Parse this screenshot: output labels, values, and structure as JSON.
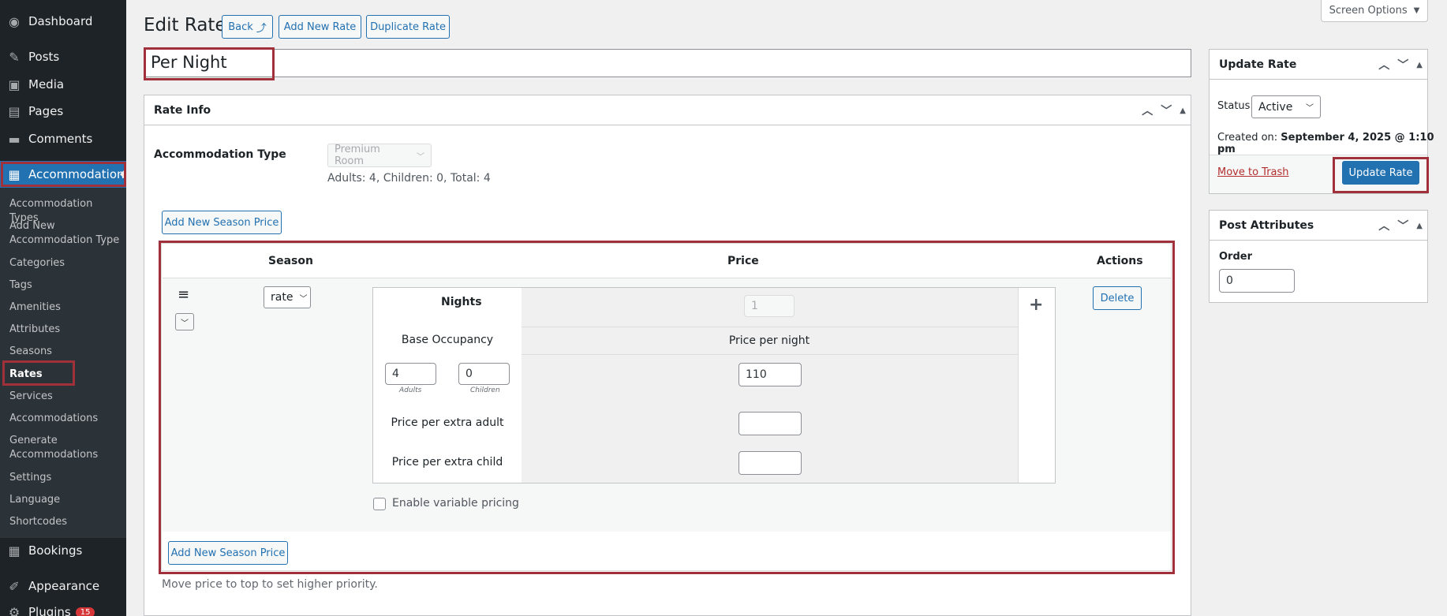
{
  "sidebar": {
    "top_items": [
      {
        "label": "Dashboard",
        "icon": "dashboard-icon"
      },
      {
        "label": "Posts",
        "icon": "pin-icon"
      },
      {
        "label": "Media",
        "icon": "media-icon"
      },
      {
        "label": "Pages",
        "icon": "page-icon"
      },
      {
        "label": "Comments",
        "icon": "comment-icon"
      },
      {
        "label": "Accommodation",
        "icon": "building-icon"
      }
    ],
    "submenu": [
      "Accommodation Types",
      "Add New Accommodation Type",
      "Categories",
      "Tags",
      "Amenities",
      "Attributes",
      "Seasons",
      "Rates",
      "Services",
      "Accommodations",
      "Generate Accommodations",
      "Settings",
      "Language",
      "Shortcodes"
    ],
    "bottom_items": [
      {
        "label": "Bookings",
        "icon": "calendar-icon"
      },
      {
        "label": "Appearance",
        "icon": "brush-icon"
      },
      {
        "label": "Plugins",
        "icon": "plugin-icon",
        "badge": "15"
      }
    ]
  },
  "header": {
    "title": "Edit Rate",
    "back_label": "Back",
    "back_icon": "⤴",
    "add_new_label": "Add New Rate",
    "duplicate_label": "Duplicate Rate",
    "screen_options": "Screen Options",
    "screen_options_icon": "▼"
  },
  "post_title": "Per Night",
  "rate_info": {
    "title": "Rate Info",
    "accommodation_type_label": "Accommodation Type",
    "accommodation_type_value": "Premium Room",
    "occupancy_summary": "Adults: 4, Children: 0, Total: 4",
    "add_season_price_label": "Add New Season Price",
    "table": {
      "col_season": "Season",
      "col_price": "Price",
      "col_actions": "Actions",
      "season_select": "rate",
      "nights_label": "Nights",
      "nights_value": "1",
      "base_occupancy_label": "Base Occupancy",
      "price_per_night_label": "Price per night",
      "adults_value": "4",
      "adults_caption": "Adults",
      "children_value": "0",
      "children_caption": "Children",
      "price_per_night_value": "110",
      "extra_adult_label": "Price per extra adult",
      "extra_adult_value": "",
      "extra_child_label": "Price per extra child",
      "extra_child_value": "",
      "variable_pricing_label": "Enable variable pricing",
      "delete_label": "Delete",
      "plus_symbol": "+"
    },
    "add_season_price_bottom_label": "Add New Season Price",
    "priority_hint": "Move price to top to set higher priority."
  },
  "update_box": {
    "title": "Update Rate",
    "status_label": "Status:",
    "status_value": "Active",
    "created_label": "Created on:",
    "created_value": "September 4, 2025 @ 1:10 pm",
    "trash_label": "Move to Trash",
    "update_button": "Update Rate"
  },
  "attributes_box": {
    "title": "Post Attributes",
    "order_label": "Order",
    "order_value": "0"
  },
  "colors": {
    "sidebar_bg": "#1d2327",
    "submenu_bg": "#2c3338",
    "accent": "#2271b1",
    "highlight": "#a0313a",
    "badge": "#d63638"
  }
}
